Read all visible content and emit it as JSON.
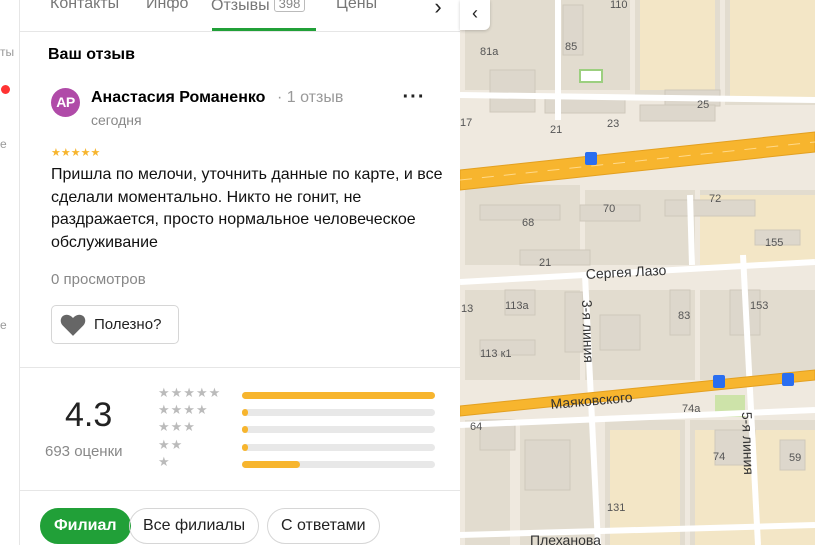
{
  "tabs": [
    {
      "label": "Контакты"
    },
    {
      "label": "Инфо"
    },
    {
      "label": "Отзывы",
      "count": "398",
      "active": true
    },
    {
      "label": "Цены"
    }
  ],
  "your_review": {
    "title": "Ваш отзыв"
  },
  "review": {
    "avatar_initials": "АР",
    "avatar_color": "#b04ba8",
    "author": "Анастасия Романенко",
    "author_meta": "· 1 отзыв",
    "date": "сегодня",
    "rating": 5,
    "text": "Пришла по мелочи, уточнить данные по карте, и все сделали моментально. Никто не гонит, не раздражается, просто нормальное человеческое обслуживание",
    "views": "0 просмотров",
    "useful_label": "Полезно?"
  },
  "rating_summary": {
    "value": "4.3",
    "count_label": "693 оценки",
    "distribution": [
      {
        "stars": 5,
        "fraction": 1.0
      },
      {
        "stars": 4,
        "fraction": 0.03
      },
      {
        "stars": 3,
        "fraction": 0.03
      },
      {
        "stars": 2,
        "fraction": 0.03
      },
      {
        "stars": 1,
        "fraction": 0.3
      }
    ]
  },
  "filters": [
    {
      "label": "Филиал",
      "active": true
    },
    {
      "label": "Все филиалы",
      "active": false
    },
    {
      "label": "С ответами",
      "active": false
    }
  ],
  "map": {
    "streets": [
      "Сергея Лазо",
      "Маяковского",
      "3-я линия",
      "5-я линия",
      "Плеханова"
    ],
    "house_numbers": [
      "110",
      "85",
      "81а",
      "17",
      "21",
      "23",
      "25",
      "68",
      "70",
      "72",
      "155",
      "21",
      "113а",
      "13",
      "83",
      "153",
      "113 к1",
      "74а",
      "64",
      "74",
      "59",
      "131"
    ]
  },
  "colors": {
    "accent": "#21a038",
    "star": "#f7b52e",
    "road": "#f7b52e"
  }
}
